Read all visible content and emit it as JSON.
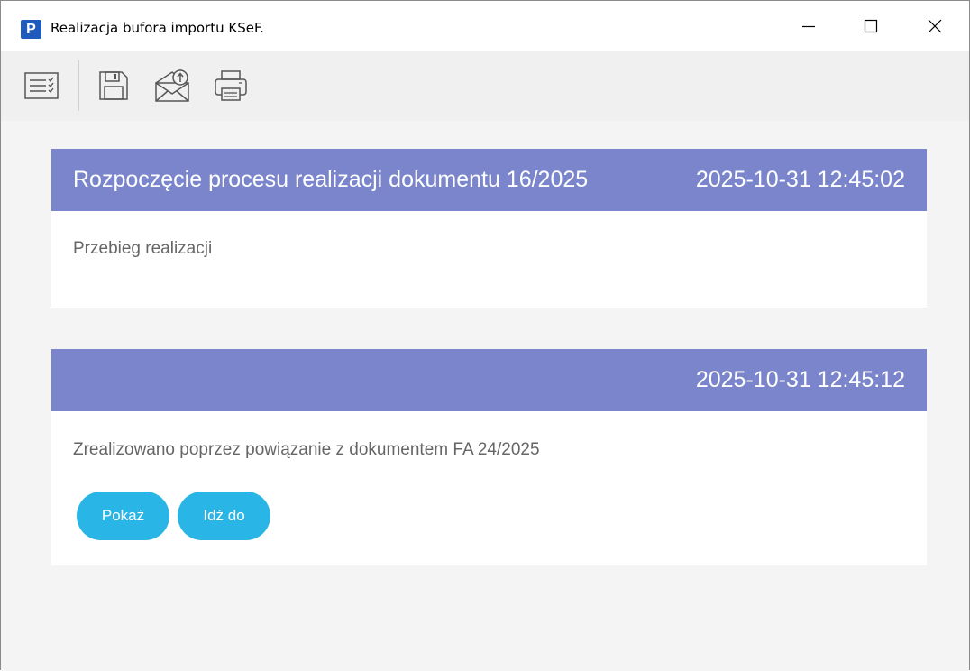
{
  "window": {
    "title": "Realizacja bufora importu KSeF.",
    "logo_letter": "P",
    "brand_color": "#1f5bbd",
    "controls": [
      "minimize-icon",
      "maximize-icon",
      "close-icon"
    ]
  },
  "toolbar": {
    "items": [
      {
        "name": "checklist-icon"
      },
      {
        "name": "save-icon"
      },
      {
        "name": "mail-send-icon"
      },
      {
        "name": "print-icon"
      }
    ]
  },
  "cards": [
    {
      "title": "Rozpoczęcie procesu realizacji dokumentu 16/2025",
      "timestamp": "2025-10-31 12:45:02",
      "text": "Przebieg realizacji"
    },
    {
      "title": "",
      "timestamp": "2025-10-31 12:45:12",
      "text": "Zrealizowano poprzez powiązanie z dokumentem FA 24/2025",
      "buttons": [
        "Pokaż",
        "Idź do"
      ]
    }
  ],
  "colors": {
    "header": "#7a85cc",
    "button": "#29b6e6",
    "text": "#666666"
  }
}
